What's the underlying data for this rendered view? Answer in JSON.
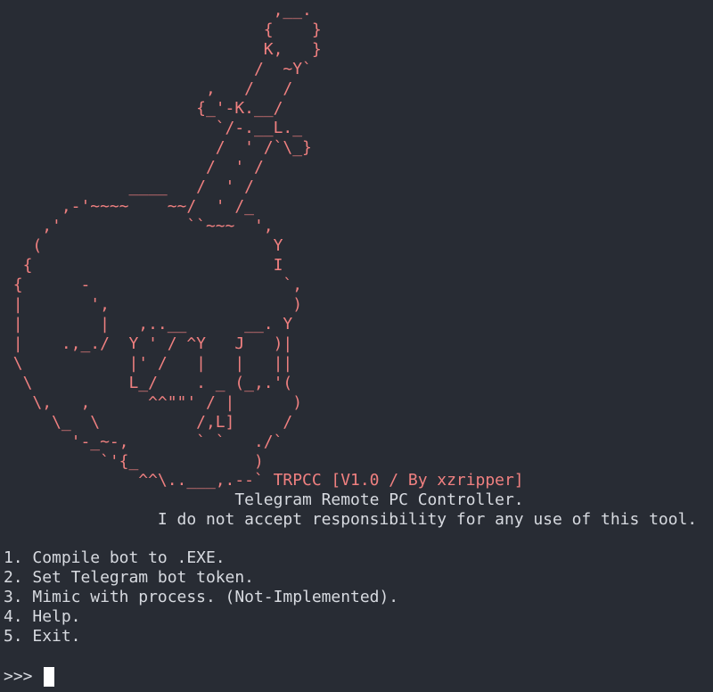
{
  "ascii_art": "                            ,__.\n                           {    }\n                           K,   }\n                          /  ~Y`\n                     ,   /   /\n                    {_'-K.__/\n                      `/-.__L._\n                      /  ' /`\\_}\n                     /  ' /\n             ____   /  ' /\n      ,-'~~~~    ~~/  ' /_\n    ,'             ``~~~  ',\n   (                        Y\n  {                         I\n {      -                    `,\n |       ',                   )\n |        |   ,..__      __. Y\n |    .,_./  Y ' / ^Y   J   )|\n \\           |' /   |   |   ||\n  \\          L_/    . _ (_,.'(\n   \\,   ,      ^^\"\"' / |      )\n     \\_  \\          /,L]     /\n       '-_~-,       ` `   ./`\n          `'{_            )",
  "version_line": "              ^^\\..___,.--` TRPCC [V1.0 / By xzripper]",
  "subtitle": "                        Telegram Remote PC Controller.",
  "disclaimer": "                I do not accept responsibility for any use of this tool.",
  "menu": [
    "1. Compile bot to .EXE.",
    "2. Set Telegram bot token.",
    "3. Mimic with process. (Not-Implemented).",
    "4. Help.",
    "5. Exit."
  ],
  "prompt": ">>> ",
  "colors": {
    "background": "#282c34",
    "art": "#f08080",
    "text": "#d7dae0",
    "cursor": "#ffffff"
  }
}
